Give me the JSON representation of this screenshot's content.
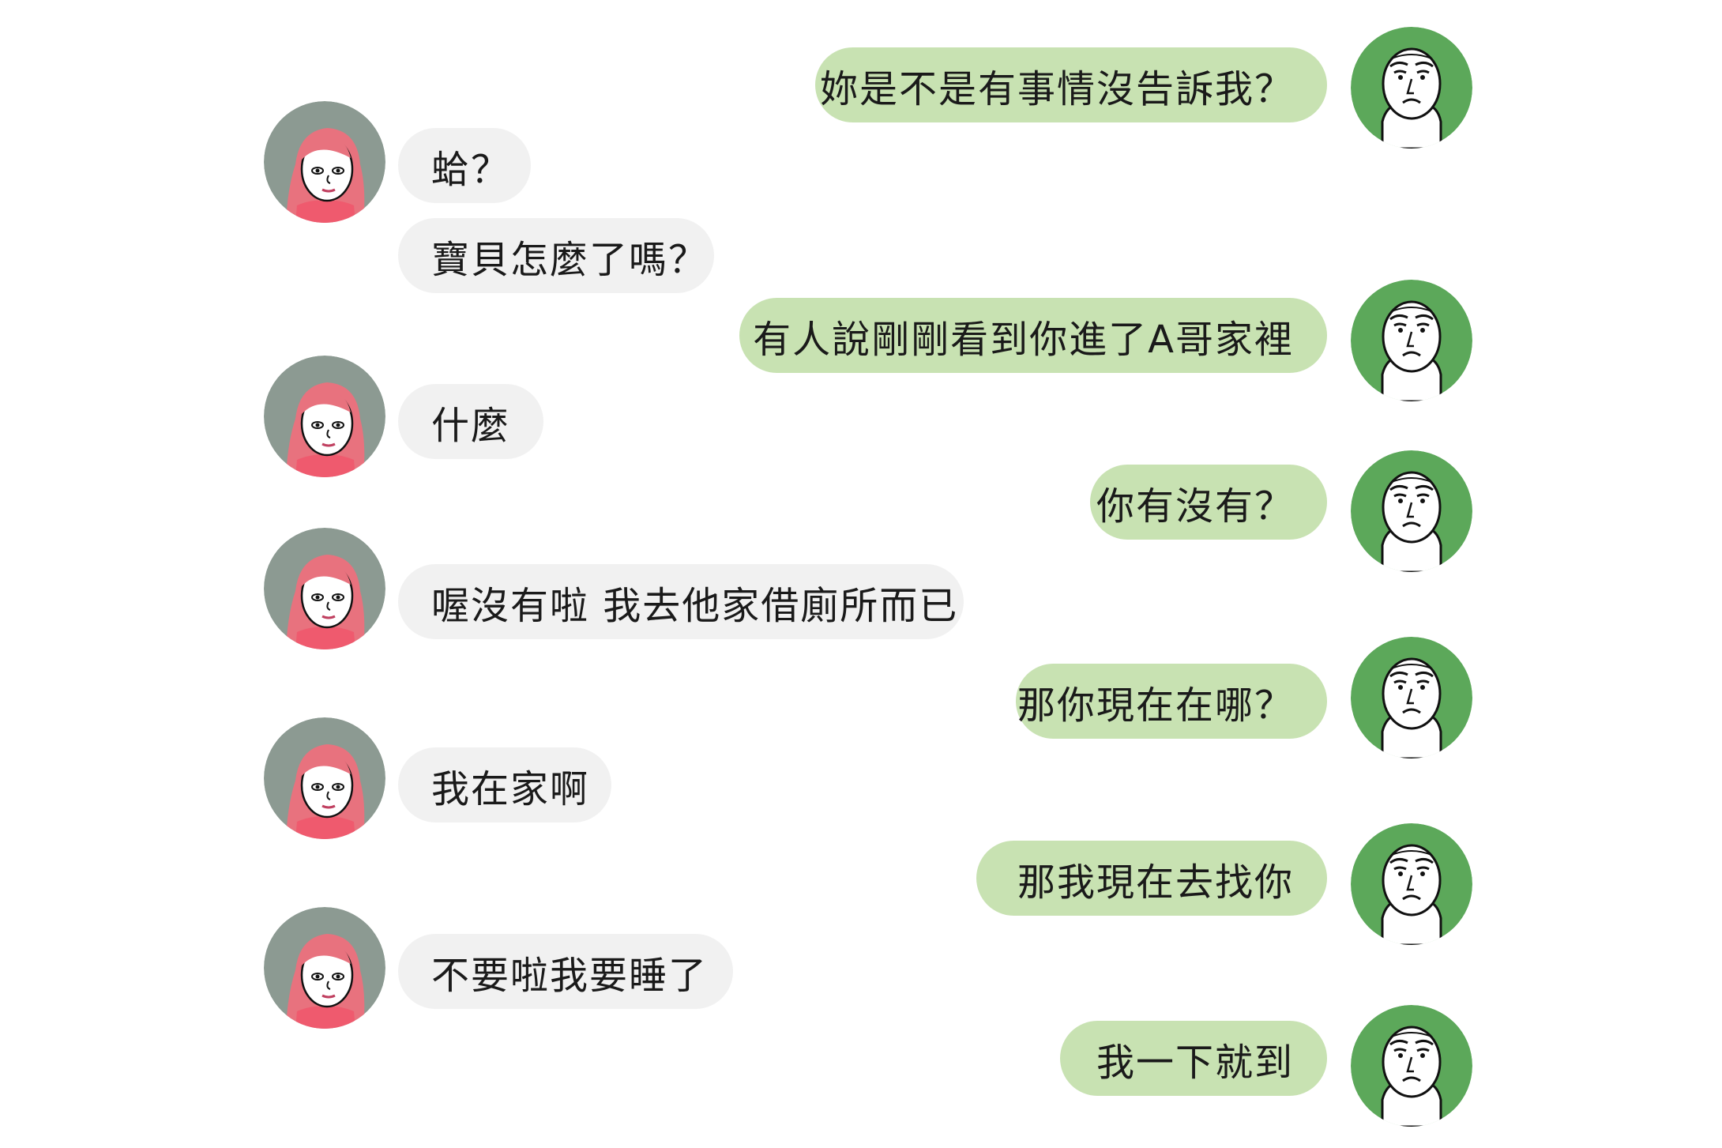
{
  "chat": {
    "participants": {
      "self": {
        "avatar_icon": "rage-face-man-icon",
        "bubble_color": "#c8e2b2",
        "avatar_bg": "#5ca85a"
      },
      "other": {
        "avatar_icon": "pink-hair-girl-icon",
        "bubble_color": "#f1f1f1",
        "avatar_bg": "#8c9a92"
      }
    },
    "messages": [
      {
        "sender": "self",
        "text": "妳是不是有事情沒告訴我？"
      },
      {
        "sender": "other",
        "text": "蛤？"
      },
      {
        "sender": "other",
        "text": "寶貝怎麼了嗎？"
      },
      {
        "sender": "self",
        "text": "有人說剛剛看到你進了A哥家裡"
      },
      {
        "sender": "other",
        "text": "什麼"
      },
      {
        "sender": "self",
        "text": "你有沒有？"
      },
      {
        "sender": "other",
        "text": "喔沒有啦 我去他家借廁所而已"
      },
      {
        "sender": "self",
        "text": "那你現在在哪？"
      },
      {
        "sender": "other",
        "text": "我在家啊"
      },
      {
        "sender": "self",
        "text": "那我現在去找你"
      },
      {
        "sender": "other",
        "text": "不要啦我要睡了"
      },
      {
        "sender": "self",
        "text": "我一下就到"
      }
    ]
  }
}
